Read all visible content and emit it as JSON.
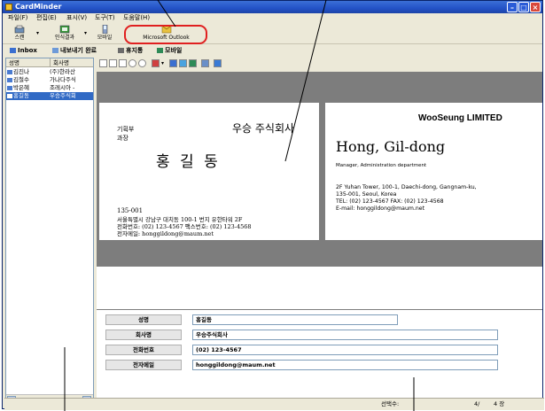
{
  "app": {
    "title": "CardMinder"
  },
  "menu": [
    "파일(F)",
    "편집(E)",
    "표시(V)",
    "도구(T)",
    "도움말(H)"
  ],
  "toolbar": {
    "buttons": [
      {
        "label": "스캔",
        "icon": "scanner-icon"
      },
      {
        "label": "인식결과",
        "icon": "recognize-icon"
      },
      {
        "label": "모바일",
        "icon": "mobile-icon"
      },
      {
        "label": "Microsoft Outlook",
        "icon": "outlook-icon"
      }
    ]
  },
  "tabs": [
    {
      "label": "Inbox",
      "icon": "inbox-icon"
    },
    {
      "label": "내보내기 완료",
      "icon": "export-done-icon"
    },
    {
      "label": "휴지통",
      "icon": "trash-icon"
    },
    {
      "label": "모바일",
      "icon": "mobile-tab-icon"
    }
  ],
  "list": {
    "columns": [
      "성명",
      "회사명"
    ],
    "rows": [
      {
        "name": "김진나",
        "company": "(주)한라산"
      },
      {
        "name": "김철수",
        "company": "가나다주식"
      },
      {
        "name": "박은혜",
        "company": "조레시아 -"
      },
      {
        "name": "홍길동",
        "company": "우승주식회"
      }
    ],
    "selected_index": 3
  },
  "card_front": {
    "title": "기획부",
    "position": "과장",
    "company": "우승 주식회사",
    "name": "홍  길  동",
    "address_line1": "135-001",
    "address_line2": "서울특별시 강남구 대치동 100-1 번지 유한타워 2F",
    "phone_line": "전화번호: (02) 123-4567     팩스번호: (02) 123-4568",
    "email_line": "전자메일: honggildong@maum.net"
  },
  "card_back": {
    "company": "WooSeung LIMITED",
    "name": "Hong, Gil-dong",
    "position": "Manager,   Administration department",
    "address_line1": "2F Yuhan Tower, 100-1, Daechi-dong, Gangnam-ku,",
    "address_line2": "135-001, Seoul, Korea",
    "phone_line": "TEL: (02) 123-4567     FAX: (02) 123-4568",
    "email_line": "E-mail: honggildong@maum.net"
  },
  "form": {
    "fields": [
      {
        "label": "성명",
        "value": "홍길동"
      },
      {
        "label": "회사명",
        "value": "우승주식회사"
      },
      {
        "label": "전화번호",
        "value": "(02) 123-4567"
      },
      {
        "label": "전자메일",
        "value": "honggildong@maum.net"
      }
    ]
  },
  "status": {
    "selected_label": "선택수:",
    "count": "4/",
    "total": "4 장"
  },
  "colors": {
    "accent": "#316ac5",
    "callout": "#e02020",
    "card_background": "#7d7d7d"
  }
}
